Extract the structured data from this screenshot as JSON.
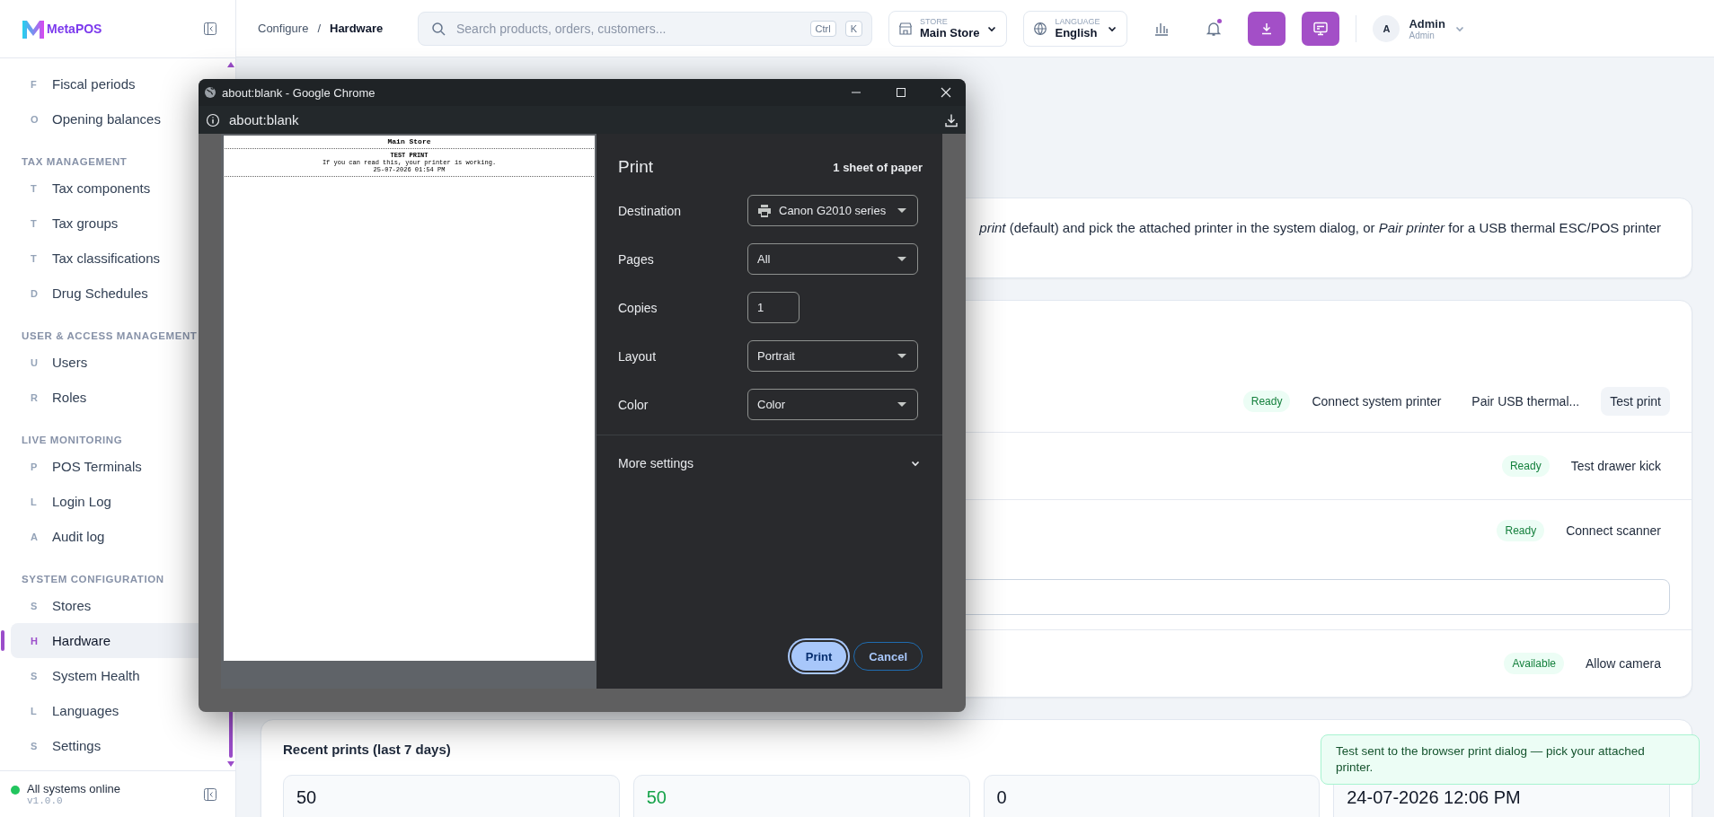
{
  "sidebar": {
    "brand": "MetaPOS",
    "sections": [
      {
        "items": [
          {
            "letter": "F",
            "label": "Fiscal periods",
            "selected": false
          },
          {
            "letter": "O",
            "label": "Opening balances",
            "selected": false
          }
        ]
      },
      {
        "heading": "TAX MANAGEMENT",
        "items": [
          {
            "letter": "T",
            "label": "Tax components",
            "selected": false
          },
          {
            "letter": "T",
            "label": "Tax groups",
            "selected": false
          },
          {
            "letter": "T",
            "label": "Tax classifications",
            "selected": false
          },
          {
            "letter": "D",
            "label": "Drug Schedules",
            "selected": false
          }
        ]
      },
      {
        "heading": "USER & ACCESS MANAGEMENT",
        "items": [
          {
            "letter": "U",
            "label": "Users",
            "selected": false
          },
          {
            "letter": "R",
            "label": "Roles",
            "selected": false
          }
        ]
      },
      {
        "heading": "LIVE MONITORING",
        "items": [
          {
            "letter": "P",
            "label": "POS Terminals",
            "selected": false
          },
          {
            "letter": "L",
            "label": "Login Log",
            "selected": false
          },
          {
            "letter": "A",
            "label": "Audit log",
            "selected": false
          }
        ]
      },
      {
        "heading": "SYSTEM CONFIGURATION",
        "items": [
          {
            "letter": "S",
            "label": "Stores",
            "selected": false
          },
          {
            "letter": "H",
            "label": "Hardware",
            "selected": true
          },
          {
            "letter": "S",
            "label": "System Health",
            "selected": false
          },
          {
            "letter": "L",
            "label": "Languages",
            "selected": false
          },
          {
            "letter": "S",
            "label": "Settings",
            "selected": false
          }
        ]
      }
    ],
    "status": "All systems online",
    "version": "v1.0.0"
  },
  "topbar": {
    "breadcrumb": [
      "Configure",
      "Hardware"
    ],
    "separator": "/",
    "search": {
      "placeholder": "Search products, orders, customers...",
      "keys": [
        "Ctrl",
        "K"
      ]
    },
    "store": {
      "label": "STORE",
      "value": "Main Store"
    },
    "language": {
      "label": "LANGUAGE",
      "value": "English"
    },
    "notifications_unread": true,
    "user": {
      "initial": "A",
      "name": "Admin",
      "role": "Admin"
    }
  },
  "info_text": "*print* (default) and pick the attached printer in the system dialog, or *Pair printer* for a USB thermal ESC/POS printer",
  "devices": [
    {
      "badge": "Ready",
      "input_field": false,
      "actions": [
        {
          "label": "Connect system printer",
          "highlighted": false
        },
        {
          "label": "Pair USB thermal...",
          "highlighted": false
        },
        {
          "label": "Test print",
          "highlighted": true
        }
      ]
    },
    {
      "badge": "Ready",
      "input_field": false,
      "actions": [
        {
          "label": "Test drawer kick",
          "highlighted": false
        }
      ]
    },
    {
      "badge": "Ready",
      "input_field": true,
      "actions": [
        {
          "label": "Connect scanner",
          "highlighted": false
        }
      ]
    },
    {
      "badge": "Available",
      "input_field": false,
      "actions": [
        {
          "label": "Allow camera",
          "highlighted": false
        }
      ]
    }
  ],
  "recent_prints": {
    "title": "Recent prints (last 7 days)",
    "stats": [
      {
        "value": "50",
        "color": "#111827"
      },
      {
        "value": "50",
        "color": "#16a34a"
      },
      {
        "value": "0",
        "color": "#111827"
      },
      {
        "value": "24-07-2026 12:06 PM",
        "color": "#111827"
      }
    ]
  },
  "toast": "Test sent to the browser print dialog — pick your attached printer.",
  "print_dialog": {
    "window_title": "about:blank - Google Chrome",
    "address": "about:blank",
    "preview": {
      "store": "Main Store",
      "heading": "TEST PRINT",
      "message": "If you can read this, your printer is working.",
      "timestamp": "25-07-2026 01:54 PM"
    },
    "title": "Print",
    "sheets": "1 sheet of paper",
    "settings": [
      {
        "label": "Destination",
        "kind": "printer",
        "value": "Canon G2010 series"
      },
      {
        "label": "Pages",
        "kind": "select",
        "value": "All"
      },
      {
        "label": "Copies",
        "kind": "number",
        "value": "1"
      },
      {
        "label": "Layout",
        "kind": "select",
        "value": "Portrait"
      },
      {
        "label": "Color",
        "kind": "select",
        "value": "Color"
      }
    ],
    "more_settings": "More settings",
    "buttons": [
      {
        "label": "Print",
        "kind": "primary"
      },
      {
        "label": "Cancel",
        "kind": "secondary"
      }
    ]
  }
}
